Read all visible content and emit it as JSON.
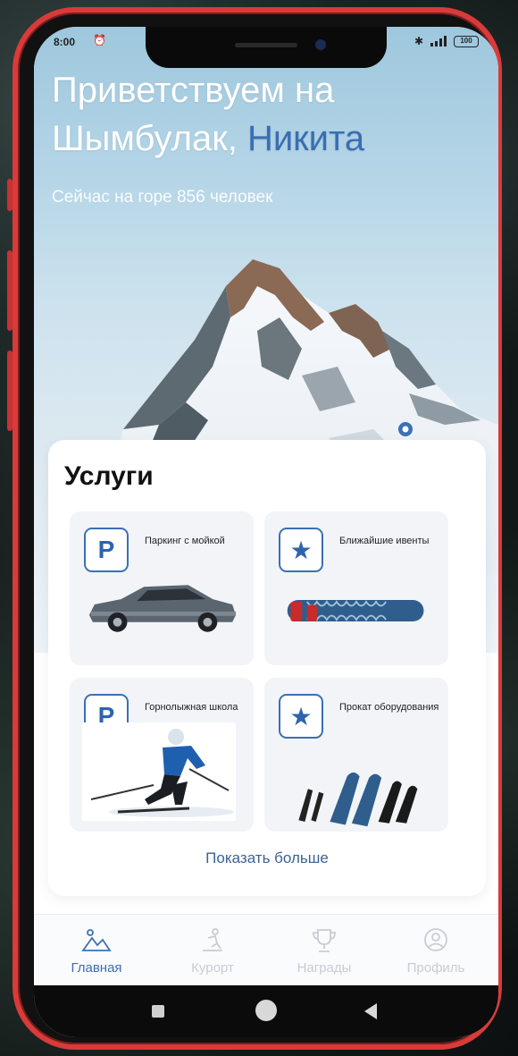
{
  "status_bar": {
    "time": "8:00",
    "battery": "100"
  },
  "hero": {
    "greeting_line1": "Приветствуем на",
    "greeting_line2_prefix": "Шымбулак,",
    "user_name": "Никита",
    "subtitle": "Сейчас на горе 856 человек"
  },
  "services": {
    "title": "Услуги",
    "tiles": [
      {
        "label": "Паркинг с мойкой",
        "icon": "parking-icon",
        "icon_glyph": "P"
      },
      {
        "label": "Ближайшие ивенты",
        "icon": "star-icon",
        "icon_glyph": "★"
      },
      {
        "label": "Горнолыжная школа",
        "icon": "parking-icon",
        "icon_glyph": "P"
      },
      {
        "label": "Прокат оборудования",
        "icon": "star-icon",
        "icon_glyph": "★"
      }
    ],
    "show_more": "Показать больше"
  },
  "tabbar": {
    "tabs": [
      {
        "label": "Главная",
        "icon": "mountain-icon",
        "active": true
      },
      {
        "label": "Курорт",
        "icon": "skier-icon",
        "active": false
      },
      {
        "label": "Награды",
        "icon": "trophy-icon",
        "active": false
      },
      {
        "label": "Профиль",
        "icon": "profile-icon",
        "active": false
      }
    ]
  },
  "colors": {
    "accent": "#3b6fb6",
    "frame": "#d93a3a",
    "tile_bg": "#f2f4f8"
  }
}
